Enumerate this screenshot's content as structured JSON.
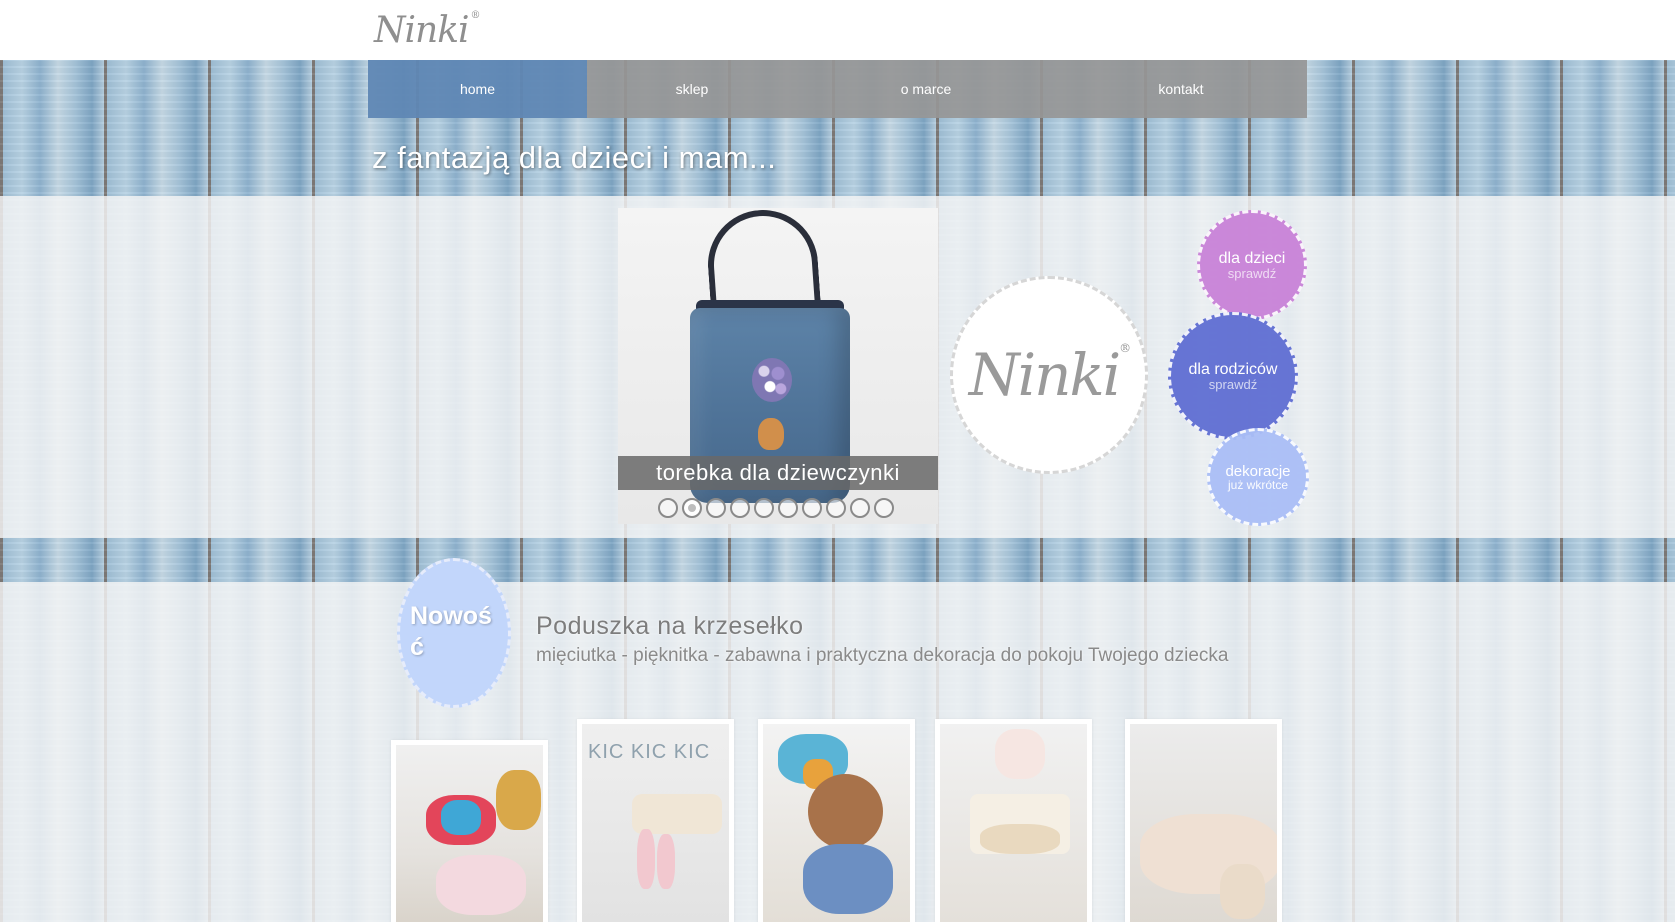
{
  "brand": {
    "name": "Ninki",
    "reg_mark": "®"
  },
  "nav": {
    "items": [
      {
        "label": "home",
        "active": true
      },
      {
        "label": "sklep",
        "active": false
      },
      {
        "label": "o marce",
        "active": false
      },
      {
        "label": "kontakt",
        "active": false
      }
    ]
  },
  "tagline": "z fantazją dla dzieci i mam...",
  "slider": {
    "caption": "torebka dla dziewczynki",
    "slide_count": 10,
    "active_index": 1
  },
  "categories": [
    {
      "title": "dla dzieci",
      "subtitle": "sprawdź",
      "color": "#c882d7"
    },
    {
      "title": "dla rodziców",
      "subtitle": "sprawdź",
      "color": "#5f6ed2"
    },
    {
      "title": "dekoracje",
      "subtitle": "już wkrótce",
      "color": "#aabef5"
    }
  ],
  "news": {
    "badge": "Nowość",
    "title": "Poduszka na krzesełko",
    "description": "mięciutka - pięknitka - zabawna i praktyczna dekoracja do pokoju Twojego dziecka",
    "thumb_text": "KIC KIC KIC"
  },
  "colors": {
    "nav_active": "#5f87b4",
    "nav_default": "#969696",
    "badge": "#c2d6fb",
    "wood_blue": "#a9c6da"
  }
}
